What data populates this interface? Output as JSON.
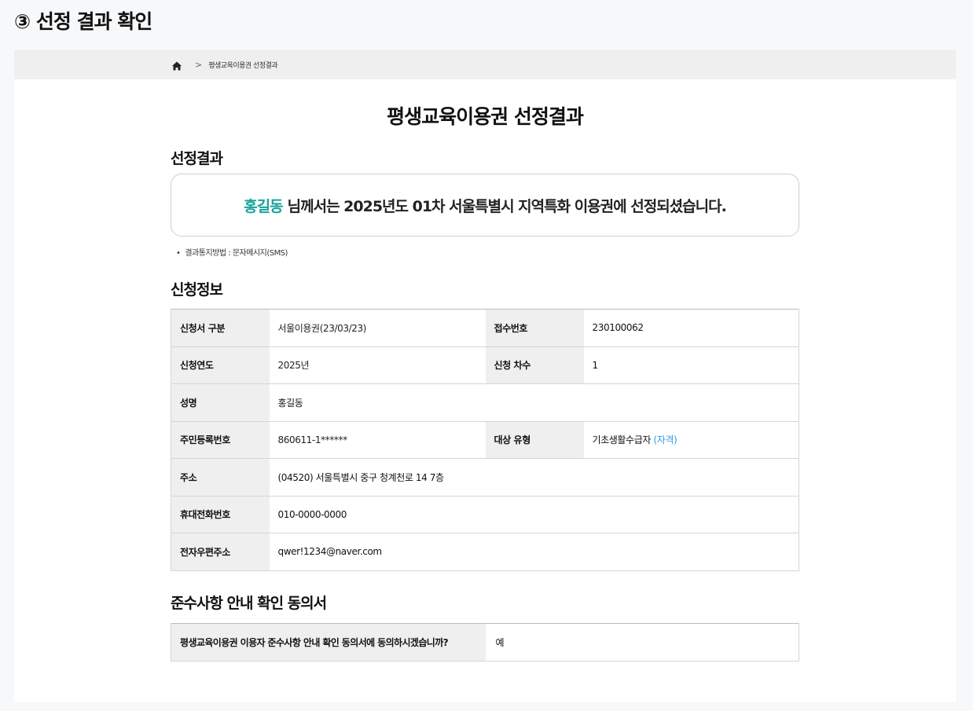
{
  "step_title": "③ 선정 결과 확인",
  "breadcrumb": {
    "home_icon": "home-icon",
    "separator": ">",
    "current": "평생교육이용권 선정결과"
  },
  "page_title": "평생교육이용권 선정결과",
  "result_section": {
    "title": "선정결과",
    "name": "홍길동",
    "message": "님께서는 2025년도 01차 서울특별시 지역특화 이용권에 선정되셨습니다.",
    "notice": "결과통지방법 : 문자메시지(SMS)",
    "name_color": "#1aa39a"
  },
  "application_section": {
    "title": "신청정보",
    "rows": [
      {
        "label1": "신청서 구분",
        "value1": "서울이용권(23/03/23)",
        "label2": "접수번호",
        "value2": "230100062"
      },
      {
        "label1": "신청연도",
        "value1": "2025년",
        "label2": "신청 차수",
        "value2": "1"
      },
      {
        "label1": "성명",
        "value1": "홍길동"
      },
      {
        "label1": "주민등록번호",
        "value1": "860611-1******",
        "label2": "대상 유형",
        "value2": "기초생활수급자",
        "value2_link": "(자격)"
      },
      {
        "label1": "주소",
        "value1": "(04520) 서울특별시 중구 청계천로 14 7층"
      },
      {
        "label1": "휴대전화번호",
        "value1": "010-0000-0000"
      },
      {
        "label1": "전자우편주소",
        "value1": "qwer!1234@naver.com"
      }
    ]
  },
  "agreement_section": {
    "title": "준수사항 안내 확인 동의서",
    "question": "평생교육이용권 이용자 준수사항 안내 확인 동의서에 동의하시겠습니까?",
    "answer": "예"
  },
  "colors": {
    "link": "#2b9be8",
    "header_bg": "#efefef"
  }
}
